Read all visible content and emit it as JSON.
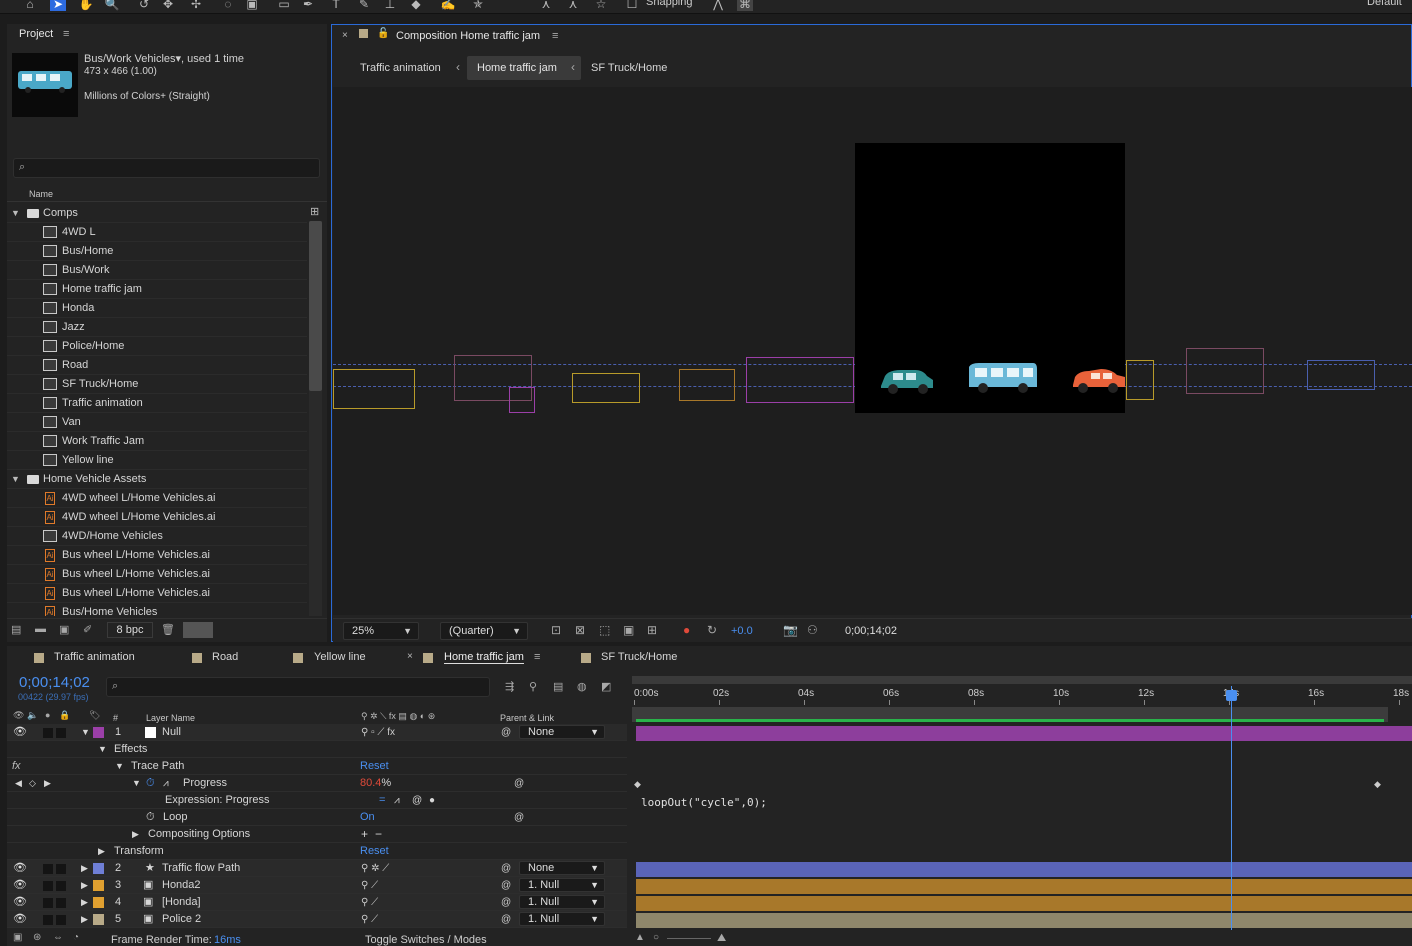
{
  "toolbar": {
    "snapping_label": "Snapping",
    "workspace_label": "Default"
  },
  "project": {
    "tab_label": "Project",
    "selected_item": {
      "name": "Bus/Work Vehicles",
      "used": ", used 1 time",
      "dimensions": "473 x 466 (1.00)",
      "colors": "Millions of Colors+ (Straight)"
    },
    "search_placeholder": "",
    "name_header": "Name",
    "rows": [
      {
        "type": "folder",
        "label": "Comps",
        "expanded": true
      },
      {
        "type": "comp",
        "label": "4WD L"
      },
      {
        "type": "comp",
        "label": "Bus/Home"
      },
      {
        "type": "comp",
        "label": "Bus/Work"
      },
      {
        "type": "comp",
        "label": "Home traffic jam"
      },
      {
        "type": "comp",
        "label": "Honda"
      },
      {
        "type": "comp",
        "label": "Jazz"
      },
      {
        "type": "comp",
        "label": "Police/Home"
      },
      {
        "type": "comp",
        "label": "Road"
      },
      {
        "type": "comp",
        "label": "SF Truck/Home"
      },
      {
        "type": "comp",
        "label": "Traffic animation"
      },
      {
        "type": "comp",
        "label": "Van"
      },
      {
        "type": "comp",
        "label": "Work Traffic Jam"
      },
      {
        "type": "comp",
        "label": "Yellow line"
      },
      {
        "type": "folder",
        "label": "Home Vehicle Assets",
        "expanded": true
      },
      {
        "type": "ai",
        "label": "4WD wheel L/Home Vehicles.ai"
      },
      {
        "type": "ai",
        "label": "4WD wheel L/Home Vehicles.ai"
      },
      {
        "type": "comp",
        "label": "4WD/Home Vehicles"
      },
      {
        "type": "ai",
        "label": "Bus wheel L/Home Vehicles.ai"
      },
      {
        "type": "ai",
        "label": "Bus wheel L/Home Vehicles.ai"
      },
      {
        "type": "ai",
        "label": "Bus wheel L/Home Vehicles.ai"
      },
      {
        "type": "ai",
        "label": "Bus/Home Vehicles"
      }
    ],
    "bpc_label": "8 bpc"
  },
  "composition": {
    "tab_label": "Composition Home traffic jam",
    "breadcrumbs": [
      "Traffic animation",
      "Home traffic jam",
      "SF Truck/Home"
    ],
    "zoom": "25%",
    "resolution": "(Quarter)",
    "exposure": "+0.0",
    "timecode": "0;00;14;02"
  },
  "timeline": {
    "tabs": [
      {
        "label": "Traffic animation",
        "color": "#b8aa88",
        "active": false
      },
      {
        "label": "Road",
        "color": "#b8aa88",
        "active": false
      },
      {
        "label": "Yellow line",
        "color": "#b8aa88",
        "active": false
      },
      {
        "label": "Home traffic jam",
        "color": "#b8aa88",
        "active": true
      },
      {
        "label": "SF Truck/Home",
        "color": "#b8aa88",
        "active": false
      }
    ],
    "timecode": "0;00;14;02",
    "frames": "00422 (29.97 fps)",
    "ruler_labels": [
      "0:00s",
      "02s",
      "04s",
      "06s",
      "08s",
      "10s",
      "12s",
      "14s",
      "16s",
      "18s"
    ],
    "headers": {
      "num": "#",
      "layer_name": "Layer Name",
      "parent_link": "Parent & Link"
    },
    "layers": {
      "l1": {
        "num": "1",
        "name": "Null",
        "parent": "None",
        "color": "#ffffff",
        "label_color": "#9b3fa8"
      },
      "effects": "Effects",
      "trace_path": "Trace Path",
      "reset": "Reset",
      "progress_label": "Progress",
      "progress_value": "80.4",
      "progress_unit": "%",
      "expression_label": "Expression: Progress",
      "expression_text": "loopOut(\"cycle\",0);",
      "loop_label": "Loop",
      "loop_value": "On",
      "compositing": "Compositing Options",
      "transform": "Transform",
      "transform_reset": "Reset",
      "l2": {
        "num": "2",
        "name": "Traffic flow Path",
        "parent": "None",
        "label_color": "#6f7fd6"
      },
      "l3": {
        "num": "3",
        "name": "Honda2",
        "parent": "1. Null",
        "label_color": "#e0a030"
      },
      "l4": {
        "num": "4",
        "name": "[Honda]",
        "parent": "1. Null",
        "label_color": "#e0a030"
      },
      "l5": {
        "num": "5",
        "name": "Police 2",
        "parent": "1. Null",
        "label_color": "#b8aa88"
      }
    },
    "status": {
      "render_label": "Frame Render Time:",
      "render_value": "16ms",
      "toggle_label": "Toggle Switches / Modes"
    }
  }
}
